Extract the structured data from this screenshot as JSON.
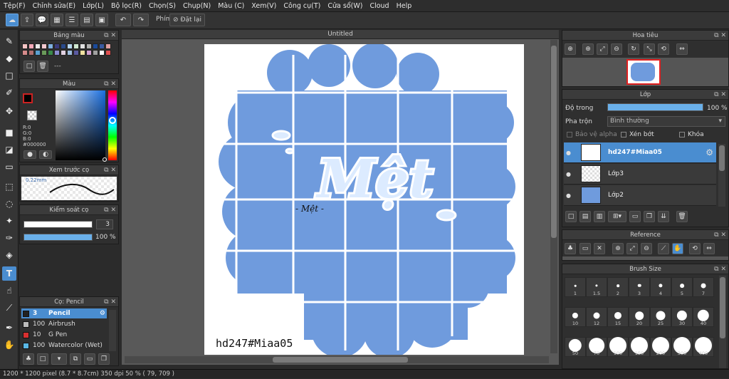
{
  "menu": [
    "Tệp(F)",
    "Chỉnh sửa(E)",
    "Lớp(L)",
    "Bộ lọc(R)",
    "Chọn(S)",
    "Chụp(N)",
    "Màu (C)",
    "Xem(V)",
    "Công cụ(T)",
    "Cửa sổ(W)",
    "Cloud",
    "Help"
  ],
  "toolbar": {
    "phim_label": "Phím",
    "reset_label": "Đặt lại"
  },
  "palette": {
    "title": "Bảng màu",
    "bottom_text": "---"
  },
  "color_panel": {
    "title": "Màu",
    "r": "R:0",
    "g": "G:0",
    "b": "B:0",
    "hex": "#000000"
  },
  "brush_preview": {
    "title": "Xem trước cọ",
    "size": "0.22mm"
  },
  "brush_control": {
    "title": "Kiểm soát cọ",
    "size_value": "3",
    "opacity_value": "100 %",
    "opacity": 1.0
  },
  "brush_list": {
    "title": "Cọ: Pencil",
    "items": [
      {
        "size": "3",
        "name": "Pencil",
        "color": "#222222",
        "selected": true
      },
      {
        "size": "100",
        "name": "Airbrush",
        "color": "#bbbbbb",
        "selected": false
      },
      {
        "size": "10",
        "name": "G Pen",
        "color": "#d93030",
        "selected": false
      },
      {
        "size": "100",
        "name": "Watercolor (Wet)",
        "color": "#5ab8e6",
        "selected": false
      }
    ]
  },
  "document": {
    "tab_title": "Untitled",
    "artwork_title": "Mệt",
    "small_text": "- Mệt -",
    "watermark": "hd247#Miaa05",
    "art_color": "#6f9bdd"
  },
  "navigator": {
    "title": "Hoa tiêu"
  },
  "layers": {
    "title": "Lớp",
    "opacity_label": "Độ trong",
    "opacity_value": "100 %",
    "opacity": 1.0,
    "blend_label": "Pha trộn",
    "blend_value": "Bình thường",
    "alpha_protect": "Bảo vệ alpha",
    "clipping": "Xén bớt",
    "lock": "Khóa",
    "items": [
      {
        "name": "hd247#Miaa05",
        "selected": true
      },
      {
        "name": "Lớp3",
        "selected": false
      },
      {
        "name": "Lớp2",
        "selected": false
      }
    ]
  },
  "reference": {
    "title": "Reference"
  },
  "brush_size": {
    "title": "Brush Size",
    "sizes": [
      "1",
      "1.5",
      "2",
      "3",
      "4",
      "5",
      "7",
      "10",
      "12",
      "15",
      "20",
      "25",
      "30",
      "40",
      "50",
      "70",
      "100",
      "150",
      "200",
      "300",
      "400"
    ]
  },
  "status": "1200 * 1200 pixel   (8.7 * 8.7cm)   350 dpi   50 %   ( 79, 709 )"
}
